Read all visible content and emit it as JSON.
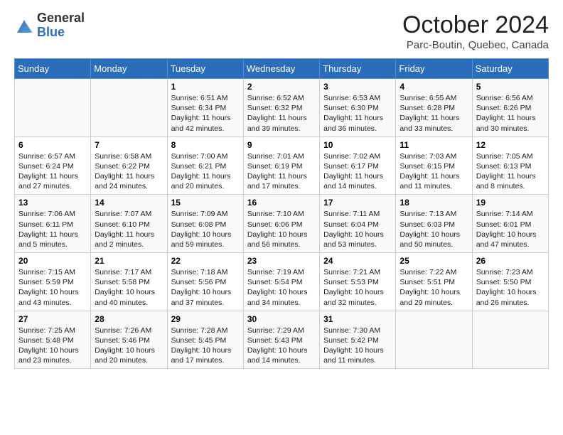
{
  "header": {
    "logo_general": "General",
    "logo_blue": "Blue",
    "month_title": "October 2024",
    "location": "Parc-Boutin, Quebec, Canada"
  },
  "days_of_week": [
    "Sunday",
    "Monday",
    "Tuesday",
    "Wednesday",
    "Thursday",
    "Friday",
    "Saturday"
  ],
  "weeks": [
    [
      {
        "day": "",
        "info": ""
      },
      {
        "day": "",
        "info": ""
      },
      {
        "day": "1",
        "info": "Sunrise: 6:51 AM\nSunset: 6:34 PM\nDaylight: 11 hours and 42 minutes."
      },
      {
        "day": "2",
        "info": "Sunrise: 6:52 AM\nSunset: 6:32 PM\nDaylight: 11 hours and 39 minutes."
      },
      {
        "day": "3",
        "info": "Sunrise: 6:53 AM\nSunset: 6:30 PM\nDaylight: 11 hours and 36 minutes."
      },
      {
        "day": "4",
        "info": "Sunrise: 6:55 AM\nSunset: 6:28 PM\nDaylight: 11 hours and 33 minutes."
      },
      {
        "day": "5",
        "info": "Sunrise: 6:56 AM\nSunset: 6:26 PM\nDaylight: 11 hours and 30 minutes."
      }
    ],
    [
      {
        "day": "6",
        "info": "Sunrise: 6:57 AM\nSunset: 6:24 PM\nDaylight: 11 hours and 27 minutes."
      },
      {
        "day": "7",
        "info": "Sunrise: 6:58 AM\nSunset: 6:22 PM\nDaylight: 11 hours and 24 minutes."
      },
      {
        "day": "8",
        "info": "Sunrise: 7:00 AM\nSunset: 6:21 PM\nDaylight: 11 hours and 20 minutes."
      },
      {
        "day": "9",
        "info": "Sunrise: 7:01 AM\nSunset: 6:19 PM\nDaylight: 11 hours and 17 minutes."
      },
      {
        "day": "10",
        "info": "Sunrise: 7:02 AM\nSunset: 6:17 PM\nDaylight: 11 hours and 14 minutes."
      },
      {
        "day": "11",
        "info": "Sunrise: 7:03 AM\nSunset: 6:15 PM\nDaylight: 11 hours and 11 minutes."
      },
      {
        "day": "12",
        "info": "Sunrise: 7:05 AM\nSunset: 6:13 PM\nDaylight: 11 hours and 8 minutes."
      }
    ],
    [
      {
        "day": "13",
        "info": "Sunrise: 7:06 AM\nSunset: 6:11 PM\nDaylight: 11 hours and 5 minutes."
      },
      {
        "day": "14",
        "info": "Sunrise: 7:07 AM\nSunset: 6:10 PM\nDaylight: 11 hours and 2 minutes."
      },
      {
        "day": "15",
        "info": "Sunrise: 7:09 AM\nSunset: 6:08 PM\nDaylight: 10 hours and 59 minutes."
      },
      {
        "day": "16",
        "info": "Sunrise: 7:10 AM\nSunset: 6:06 PM\nDaylight: 10 hours and 56 minutes."
      },
      {
        "day": "17",
        "info": "Sunrise: 7:11 AM\nSunset: 6:04 PM\nDaylight: 10 hours and 53 minutes."
      },
      {
        "day": "18",
        "info": "Sunrise: 7:13 AM\nSunset: 6:03 PM\nDaylight: 10 hours and 50 minutes."
      },
      {
        "day": "19",
        "info": "Sunrise: 7:14 AM\nSunset: 6:01 PM\nDaylight: 10 hours and 47 minutes."
      }
    ],
    [
      {
        "day": "20",
        "info": "Sunrise: 7:15 AM\nSunset: 5:59 PM\nDaylight: 10 hours and 43 minutes."
      },
      {
        "day": "21",
        "info": "Sunrise: 7:17 AM\nSunset: 5:58 PM\nDaylight: 10 hours and 40 minutes."
      },
      {
        "day": "22",
        "info": "Sunrise: 7:18 AM\nSunset: 5:56 PM\nDaylight: 10 hours and 37 minutes."
      },
      {
        "day": "23",
        "info": "Sunrise: 7:19 AM\nSunset: 5:54 PM\nDaylight: 10 hours and 34 minutes."
      },
      {
        "day": "24",
        "info": "Sunrise: 7:21 AM\nSunset: 5:53 PM\nDaylight: 10 hours and 32 minutes."
      },
      {
        "day": "25",
        "info": "Sunrise: 7:22 AM\nSunset: 5:51 PM\nDaylight: 10 hours and 29 minutes."
      },
      {
        "day": "26",
        "info": "Sunrise: 7:23 AM\nSunset: 5:50 PM\nDaylight: 10 hours and 26 minutes."
      }
    ],
    [
      {
        "day": "27",
        "info": "Sunrise: 7:25 AM\nSunset: 5:48 PM\nDaylight: 10 hours and 23 minutes."
      },
      {
        "day": "28",
        "info": "Sunrise: 7:26 AM\nSunset: 5:46 PM\nDaylight: 10 hours and 20 minutes."
      },
      {
        "day": "29",
        "info": "Sunrise: 7:28 AM\nSunset: 5:45 PM\nDaylight: 10 hours and 17 minutes."
      },
      {
        "day": "30",
        "info": "Sunrise: 7:29 AM\nSunset: 5:43 PM\nDaylight: 10 hours and 14 minutes."
      },
      {
        "day": "31",
        "info": "Sunrise: 7:30 AM\nSunset: 5:42 PM\nDaylight: 10 hours and 11 minutes."
      },
      {
        "day": "",
        "info": ""
      },
      {
        "day": "",
        "info": ""
      }
    ]
  ]
}
